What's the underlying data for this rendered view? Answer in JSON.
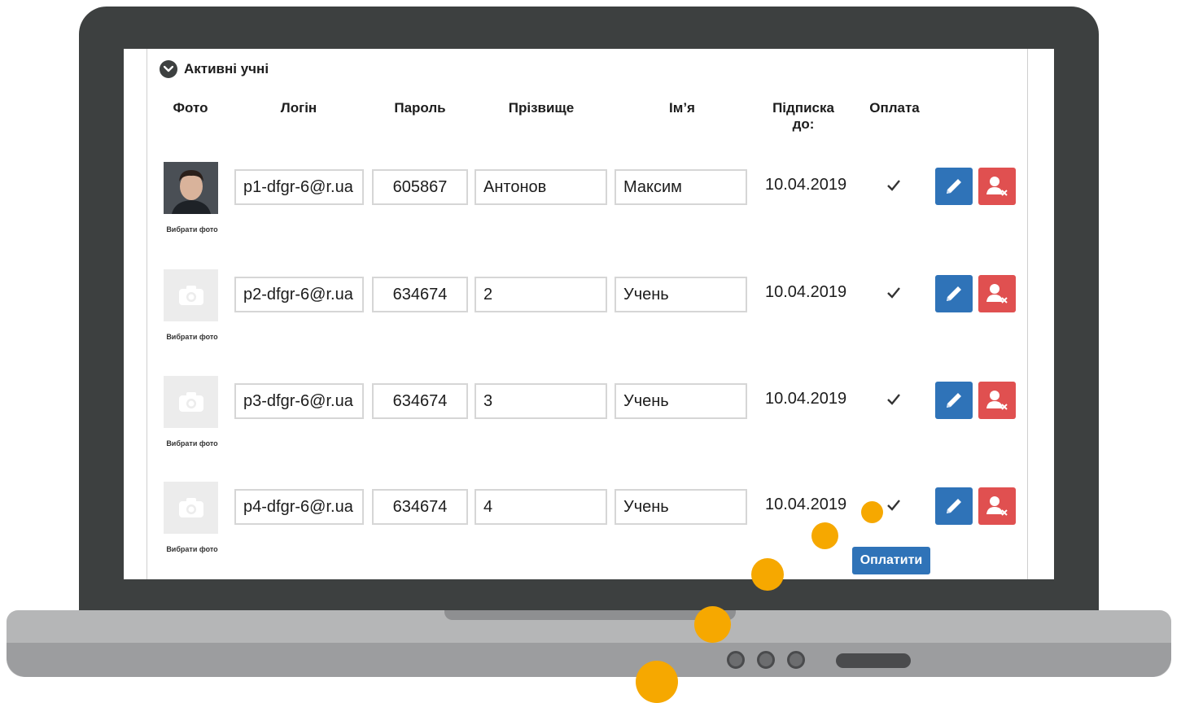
{
  "section": {
    "title": "Активні учні"
  },
  "columns": {
    "photo": "Фото",
    "login": "Логін",
    "password": "Пароль",
    "surname": "Прізвище",
    "name": "Ім’я",
    "subscription_line1": "Підписка",
    "subscription_line2": "до:",
    "payment": "Оплата"
  },
  "students": [
    {
      "photo_caption": "Вибрати фото",
      "has_photo": true,
      "login": "p1-dfgr-6@r.ua",
      "password": "605867",
      "surname": "Антонов",
      "name": "Максим",
      "subscription": "10.04.2019",
      "paid": true
    },
    {
      "photo_caption": "Вибрати фото",
      "has_photo": false,
      "login": "p2-dfgr-6@r.ua",
      "password": "634674",
      "surname": "2",
      "name": "Учень",
      "subscription": "10.04.2019",
      "paid": true
    },
    {
      "photo_caption": "Вибрати фото",
      "has_photo": false,
      "login": "p3-dfgr-6@r.ua",
      "password": "634674",
      "surname": "3",
      "name": "Учень",
      "subscription": "10.04.2019",
      "paid": true
    },
    {
      "photo_caption": "Вибрати фото",
      "has_photo": false,
      "login": "p4-dfgr-6@r.ua",
      "password": "634674",
      "surname": "4",
      "name": "Учень",
      "subscription": "10.04.2019",
      "paid": true
    }
  ],
  "pay_button": "Оплатити",
  "icons": {
    "section_toggle": "chevron-down-icon",
    "photo_placeholder": "camera-icon",
    "edit": "pencil-icon",
    "delete": "user-remove-icon",
    "paid": "checkmark-icon"
  },
  "colors": {
    "edit_button": "#2f73b8",
    "delete_button": "#e05050",
    "pay_button": "#2f73b8",
    "highlight_dots": "#f6a800",
    "laptop_frame": "#3d4040"
  }
}
